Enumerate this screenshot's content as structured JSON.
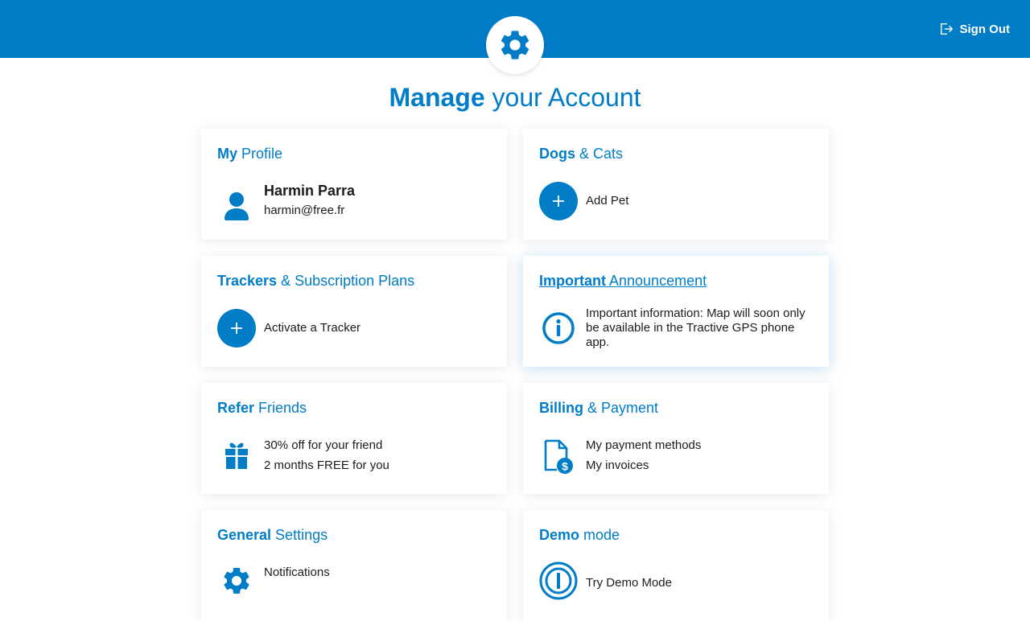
{
  "header": {
    "sign_out_label": "Sign Out",
    "logo_icon": "gear-icon",
    "colors": {
      "brand": "#017dc8",
      "background": "#ffffff",
      "text": "#1c1c1c"
    }
  },
  "page": {
    "title_bold": "Manage",
    "title_rest": " your Account"
  },
  "cards": {
    "profile": {
      "title_bold": "My",
      "title_rest": " Profile",
      "icon": "user-icon",
      "name": "Harmin Parra",
      "email": "harmin@free.fr"
    },
    "pets": {
      "title_bold": "Dogs",
      "title_rest": " & Cats",
      "icon": "plus-icon",
      "action": "Add Pet"
    },
    "trackers": {
      "title_bold": "Trackers",
      "title_rest": " & Subscription Plans",
      "icon": "plus-icon",
      "action": "Activate a Tracker"
    },
    "announcement": {
      "title_bold": "Important",
      "title_rest": " Announcement",
      "icon": "info-icon",
      "text": "Important information: Map will soon only be available in the Tractive GPS phone app."
    },
    "refer": {
      "title_bold": "Refer",
      "title_rest": " Friends",
      "icon": "gift-icon",
      "line1": "30% off for your friend",
      "line2": "2 months FREE for you"
    },
    "billing": {
      "title_bold": "Billing",
      "title_rest": " & Payment",
      "icon": "invoice-dollar-icon",
      "line1": "My payment methods",
      "line2": "My invoices"
    },
    "settings": {
      "title_bold": "General",
      "title_rest": " Settings",
      "icon": "gear-icon",
      "line1": "Notifications"
    },
    "demo": {
      "title_bold": "Demo",
      "title_rest": " mode",
      "icon": "demo-icon",
      "line1": "Try Demo Mode"
    }
  }
}
